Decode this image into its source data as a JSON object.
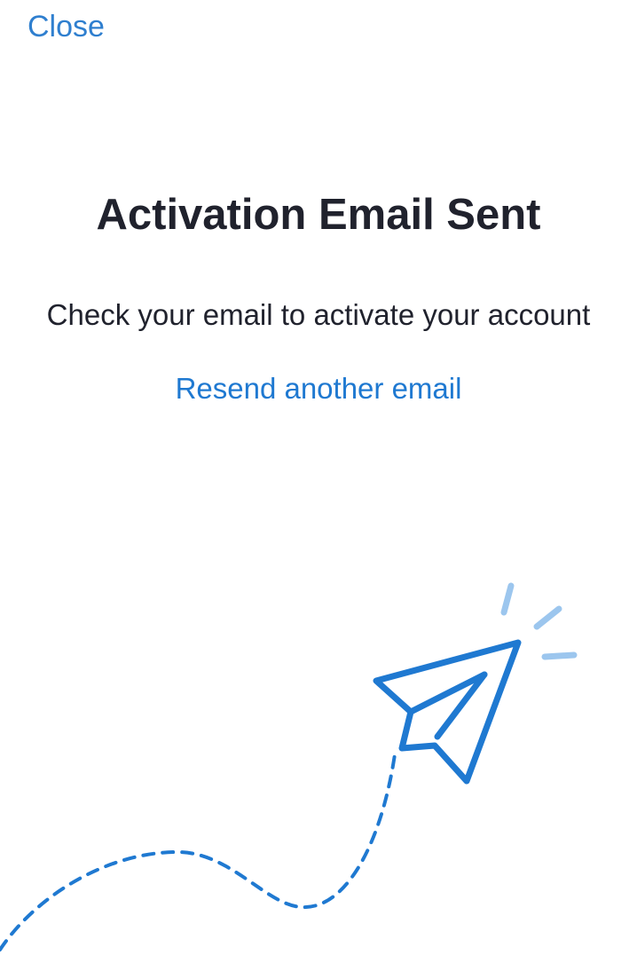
{
  "header": {
    "close_label": "Close"
  },
  "content": {
    "title": "Activation Email Sent",
    "message": "Check your email to activate your account",
    "resend_label": "Resend another email"
  },
  "illustration": {
    "icon": "paper-plane-icon",
    "stroke_color": "#1f79d1",
    "accent_color": "#9cc6ee",
    "trail_color": "#1f79d1"
  },
  "colors": {
    "link": "#1f79d1",
    "text": "#20222d",
    "background": "#ffffff"
  }
}
